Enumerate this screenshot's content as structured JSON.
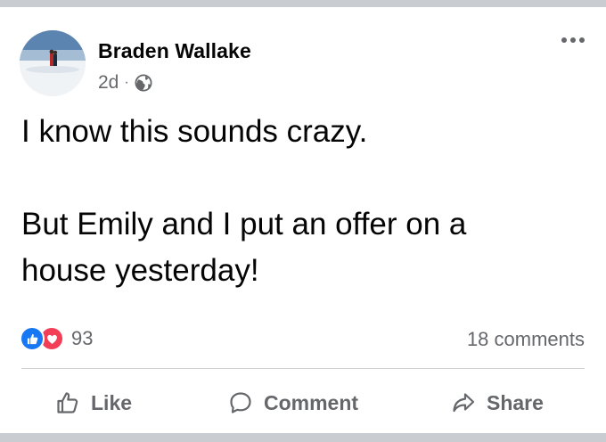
{
  "post": {
    "author": "Braden Wallake",
    "time": "2d",
    "separator": "·",
    "audience_icon": "globe-icon",
    "more_icon": "more-options-icon",
    "text_lines": [
      "I know this sounds crazy.",
      "",
      "But Emily and I put an offer on a",
      "house yesterday!"
    ]
  },
  "stats": {
    "reaction_icons": [
      "like-reaction-icon",
      "love-reaction-icon"
    ],
    "reaction_count": "93",
    "comments_count": "18 comments"
  },
  "actions": {
    "like_label": "Like",
    "comment_label": "Comment",
    "share_label": "Share"
  },
  "colors": {
    "like_blue": "#1877f2",
    "love_red": "#f33e58",
    "secondary_text": "#65676b",
    "primary_text": "#050505",
    "frame_gray": "#c9ccd1"
  }
}
